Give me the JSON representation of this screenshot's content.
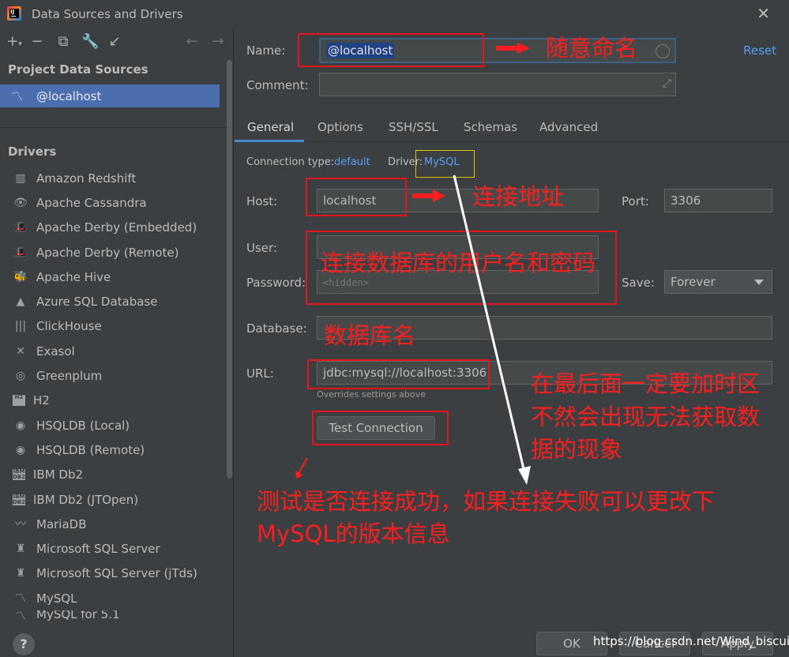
{
  "window": {
    "title": "Data Sources and Drivers",
    "logo_text": "IJ"
  },
  "toolbar": {
    "icons": [
      "plus-icon",
      "minus-icon",
      "copy-icon",
      "wrench-icon",
      "import-icon",
      "back-arrow-icon",
      "forward-arrow-icon"
    ]
  },
  "left": {
    "project_title": "Project Data Sources",
    "data_source": "@localhost",
    "drivers_title": "Drivers",
    "drivers": [
      "Amazon Redshift",
      "Apache Cassandra",
      "Apache Derby (Embedded)",
      "Apache Derby (Remote)",
      "Apache Hive",
      "Azure SQL Database",
      "ClickHouse",
      "Exasol",
      "Greenplum",
      "H2",
      "HSQLDB (Local)",
      "HSQLDB (Remote)",
      "IBM Db2",
      "IBM Db2 (JTOpen)",
      "MariaDB",
      "Microsoft SQL Server",
      "Microsoft SQL Server (jTds)",
      "MySQL",
      "MySQL for 5.1"
    ],
    "help": "?"
  },
  "form": {
    "name_label": "Name:",
    "name_value": "@localhost",
    "reset": "Reset",
    "comment_label": "Comment:",
    "tabs": [
      "General",
      "Options",
      "SSH/SSL",
      "Schemas",
      "Advanced"
    ],
    "connection_type_label": "Connection type:",
    "connection_type_value": "default",
    "driver_label": "Driver:",
    "driver_value": "MySQL",
    "host_label": "Host:",
    "host_value": "localhost",
    "port_label": "Port:",
    "port_value": "3306",
    "user_label": "User:",
    "password_label": "Password:",
    "password_placeholder": "<hidden>",
    "save_label": "Save:",
    "save_value": "Forever",
    "database_label": "Database:",
    "url_label": "URL:",
    "url_value": "jdbc:mysql://localhost:3306",
    "url_hint": "Overrides settings above",
    "test_connection": "Test Connection",
    "ok": "OK",
    "cancel": "Cancel",
    "apply": "Apply"
  },
  "annotations": {
    "name": "随意命名",
    "host": "连接地址",
    "credentials": "连接数据库的用户名和密码",
    "database": "数据库名",
    "timezone_1": "在最后面一定要加时区",
    "timezone_2": "不然会出现无法获取数",
    "timezone_3": "据的现象",
    "test_1": "测试是否连接成功，如果连接失败可以更改下",
    "test_2": "MySQL的版本信息"
  },
  "watermark": "https://blog.csdn.net/Wind_biscuit",
  "colors": {
    "background": "#3c3f41",
    "selection": "#4b6eaf",
    "link": "#589df6",
    "annotation": "#ff1e1e"
  }
}
